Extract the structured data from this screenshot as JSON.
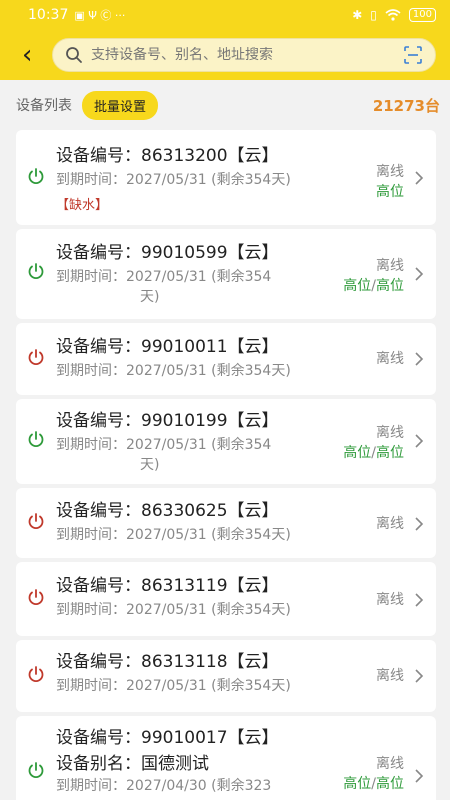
{
  "status_bar": {
    "time": "10:37",
    "left_glyphs": "▣ Ψ Ⓒ ···",
    "battery": "100"
  },
  "header": {
    "back_label": "‹",
    "search_placeholder": "支持设备号、别名、地址搜索"
  },
  "toolbar": {
    "list_title": "设备列表",
    "batch_label": "批量设置",
    "count": "21273台"
  },
  "colors": {
    "brand_yellow": "#f7d81c",
    "online_green": "#2e9a3a",
    "offline_red": "#c0392b",
    "count_orange": "#e58c2a"
  },
  "devices": [
    {
      "number": "设备编号：86313200【云】",
      "expiry_line1": "到期时间：2027/05/31 (剩余354天)",
      "expiry_line2": "",
      "tag": "【缺水】",
      "status_top": "离线",
      "status_bottom": "高位",
      "power": "green"
    },
    {
      "number": "设备编号：99010599【云】",
      "expiry_line1": "到期时间：2027/05/31 (剩余354",
      "expiry_line2": "天)",
      "status_top": "离线",
      "status_bottom_a": "高位",
      "status_bottom_b": "高位",
      "power": "green"
    },
    {
      "number": "设备编号：99010011【云】",
      "expiry_line1": "到期时间：2027/05/31 (剩余354天)",
      "status_top": "离线",
      "power": "red"
    },
    {
      "number": "设备编号：99010199【云】",
      "expiry_line1": "到期时间：2027/05/31 (剩余354",
      "expiry_line2": "天)",
      "status_top": "离线",
      "status_bottom_a": "高位",
      "status_bottom_b": "高位",
      "power": "green"
    },
    {
      "number": "设备编号：86330625【云】",
      "expiry_line1": "到期时间：2027/05/31 (剩余354天)",
      "status_top": "离线",
      "power": "red"
    },
    {
      "number": "设备编号：86313119【云】",
      "expiry_line1": "到期时间：2027/05/31 (剩余354天)",
      "status_top": "离线",
      "power": "red"
    },
    {
      "number": "设备编号：86313118【云】",
      "expiry_line1": "到期时间：2027/05/31 (剩余354天)",
      "status_top": "离线",
      "power": "red"
    },
    {
      "number": "设备编号：99010017【云】",
      "alias": "设备别名：国德测试",
      "expiry_line1": "到期时间：2027/04/30 (剩余323",
      "status_top": "离线",
      "status_bottom_a": "高位",
      "status_bottom_b": "高位",
      "power": "green"
    }
  ]
}
